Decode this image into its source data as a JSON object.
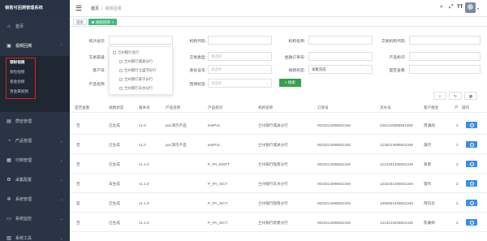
{
  "app": {
    "title": "销售可回溯管理系统"
  },
  "sidebar": {
    "items": [
      {
        "label": "首页",
        "icon": "home-icon"
      },
      {
        "label": "视频回溯",
        "icon": "video-icon"
      },
      {
        "label": "质检管理",
        "icon": "document-icon"
      },
      {
        "label": "产品管理",
        "icon": "chart-icon"
      },
      {
        "label": "归档管理",
        "icon": "archive-icon"
      },
      {
        "label": "采集配置",
        "icon": "config-icon"
      },
      {
        "label": "系统管理",
        "icon": "gear-icon"
      },
      {
        "label": "系统监控",
        "icon": "monitor-icon"
      },
      {
        "label": "系统工具",
        "icon": "tools-icon"
      }
    ],
    "submenu": [
      "理财视频",
      "保险视频",
      "基金视频",
      "贵金属视频"
    ]
  },
  "topbar": {
    "breadcrumb": [
      "首页",
      "视频回溯"
    ],
    "separator": "/",
    "avatar_text": "TT"
  },
  "tags": [
    {
      "label": "首页"
    },
    {
      "label": "视频回溯"
    }
  ],
  "filters": {
    "stats_org_label": "统计层次:",
    "org_code_label": "机构代码:",
    "org_name_label": "机构名称:",
    "trade_org_code_label": "交易机构代码:",
    "channel_label": "交易渠道:",
    "trade_type_label": "交易类型:",
    "trade_type_placeholder": "请选择",
    "order_no_label": "金融订单号:",
    "product_code_label": "产品标识:",
    "client_no_label": "客户号:",
    "id_type_label": "身份证号:",
    "id_type_placeholder": "请选择",
    "video_status_label": "视频状态:",
    "video_status_value": "采集完成",
    "review_label": "是否查看:",
    "product_name_label": "产品名称:",
    "trace_status_label": "回溯状态:",
    "trace_status_placeholder": "请选择",
    "search_label": "搜索"
  },
  "dropdown": [
    "兰州银行总行",
    "兰州银行城关分行",
    "兰州银行七里河分行",
    "兰州银行安宁分行",
    "兰州银行天水分行"
  ],
  "table": {
    "headers": [
      "是否查看",
      "视频状态",
      "版本号",
      "产品名称",
      "产品标识",
      "机构名称",
      "订单号",
      "流水号",
      "客户姓名",
      "产",
      "操作"
    ],
    "rows": [
      [
        "否",
        "已生成",
        "v1.0",
        "poc演示产品",
        "testPoc",
        "兰州银行城关分行",
        "0023214085831346",
        "2361140685831469",
        "周满勋",
        "2"
      ],
      [
        "否",
        "已生成",
        "v1.0",
        "poc演示产品",
        "testPoc",
        "兰州银行城关分行",
        "0023214085831346",
        "1235214085831346",
        "蒲月",
        "2"
      ],
      [
        "否",
        "已生成",
        "v1.1.0",
        "",
        "P_PA_EWFT",
        "兰州银行陇南分行",
        "0023214085831346",
        "1214181405831346",
        "黄勇",
        "2"
      ],
      [
        "否",
        "未生成",
        "v1.1.0",
        "",
        "P_PA_SICT",
        "兰州银行天水分行",
        "0023214085831346",
        "1232151405831346",
        "雷鸣",
        "2"
      ],
      [
        "是",
        "已生成",
        "v1.1.0",
        "",
        "P_PA_SICT",
        "兰州银行陇南分行",
        "0023214085831346",
        "1356661405831346",
        "周符云",
        "2"
      ],
      [
        "否",
        "已生成",
        "v1.1.0",
        "",
        "P_PA_SICT",
        "兰州银行新建分行",
        "0023214085831346",
        "1313213405831346",
        "陈蒹婷",
        "2"
      ]
    ]
  }
}
